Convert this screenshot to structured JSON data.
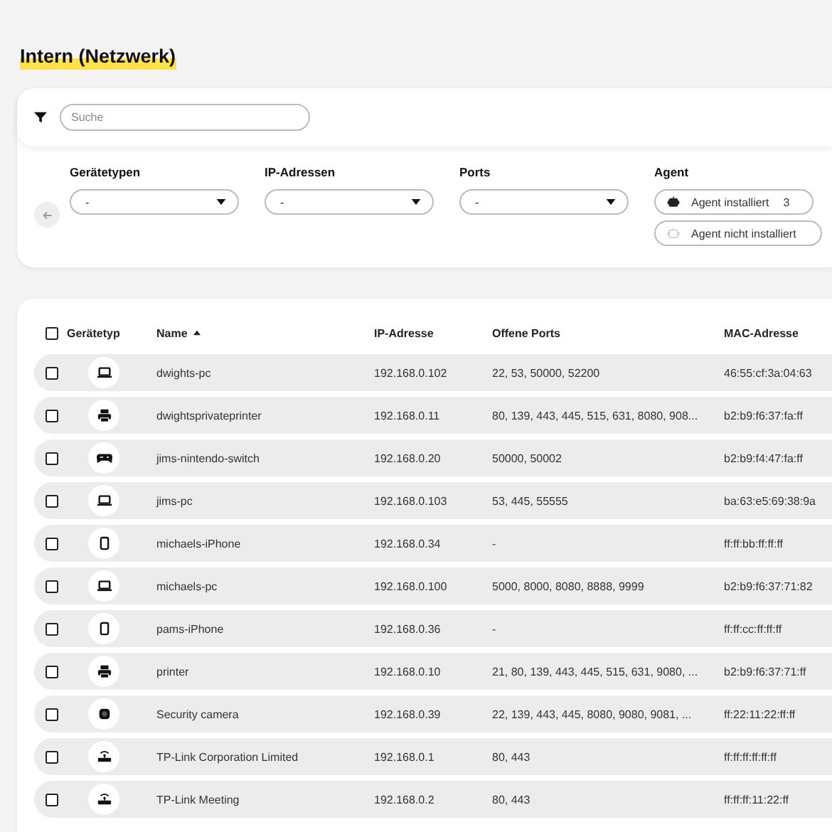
{
  "page_title": "Intern (Netzwerk)",
  "search": {
    "placeholder": "Suche"
  },
  "filters": [
    {
      "label": "Gerätetypen",
      "value": "-"
    },
    {
      "label": "IP-Adressen",
      "value": "-"
    },
    {
      "label": "Ports",
      "value": "-"
    }
  ],
  "agent_filter": {
    "label": "Agent",
    "options": [
      {
        "kind": "installed",
        "label": "Agent installiert",
        "count": "3"
      },
      {
        "kind": "not_installed",
        "label": "Agent nicht installiert"
      }
    ]
  },
  "table": {
    "select_all": {
      "checked": false
    },
    "columns": [
      {
        "label": "Gerätetyp"
      },
      {
        "label": "Name",
        "sort_ascending": true
      },
      {
        "label": "IP-Adresse"
      },
      {
        "label": "Offene Ports"
      },
      {
        "label": "MAC-Adresse"
      }
    ],
    "rows": [
      {
        "checked": false,
        "kind": "laptop",
        "name": "dwights-pc",
        "ip": "192.168.0.102",
        "ports": "22, 53, 50000, 52200",
        "mac": "46:55:cf:3a:04:63"
      },
      {
        "checked": false,
        "kind": "printer",
        "name": "dwightsprivateprinter",
        "ip": "192.168.0.11",
        "ports": "80, 139, 443, 445, 515, 631, 8080, 908...",
        "mac": "b2:b9:f6:37:fa:ff"
      },
      {
        "checked": false,
        "kind": "gamepad",
        "name": "jims-nintendo-switch",
        "ip": "192.168.0.20",
        "ports": "50000, 50002",
        "mac": "b2:b9:f4:47:fa:ff"
      },
      {
        "checked": false,
        "kind": "laptop",
        "name": "jims-pc",
        "ip": "192.168.0.103",
        "ports": "53, 445, 55555",
        "mac": "ba:63:e5:69:38:9a"
      },
      {
        "checked": false,
        "kind": "phone",
        "name": "michaels-iPhone",
        "ip": "192.168.0.34",
        "ports": "-",
        "mac": "ff:ff:bb:ff:ff:ff"
      },
      {
        "checked": false,
        "kind": "laptop",
        "name": "michaels-pc",
        "ip": "192.168.0.100",
        "ports": "5000, 8000, 8080, 8888, 9999",
        "mac": "b2:b9:f6:37:71:82"
      },
      {
        "checked": false,
        "kind": "phone",
        "name": "pams-iPhone",
        "ip": "192.168.0.36",
        "ports": "-",
        "mac": "ff:ff:cc:ff:ff:ff"
      },
      {
        "checked": false,
        "kind": "printer",
        "name": "printer",
        "ip": "192.168.0.10",
        "ports": "21, 80, 139, 443, 445, 515, 631, 9080, ...",
        "mac": "b2:b9:f6:37:71:ff"
      },
      {
        "checked": false,
        "kind": "camera",
        "name": "Security camera",
        "ip": "192.168.0.39",
        "ports": "22, 139, 443, 445, 8080, 9080, 9081, ...",
        "mac": "ff:22:11:22:ff:ff"
      },
      {
        "checked": false,
        "kind": "router",
        "name": "TP-Link Corporation Limited",
        "ip": "192.168.0.1",
        "ports": "80, 443",
        "mac": "ff:ff:ff:ff:ff:ff"
      },
      {
        "checked": false,
        "kind": "router",
        "name": "TP-Link Meeting",
        "ip": "192.168.0.2",
        "ports": "80, 443",
        "mac": "ff:ff:ff:11:22:ff"
      }
    ]
  }
}
